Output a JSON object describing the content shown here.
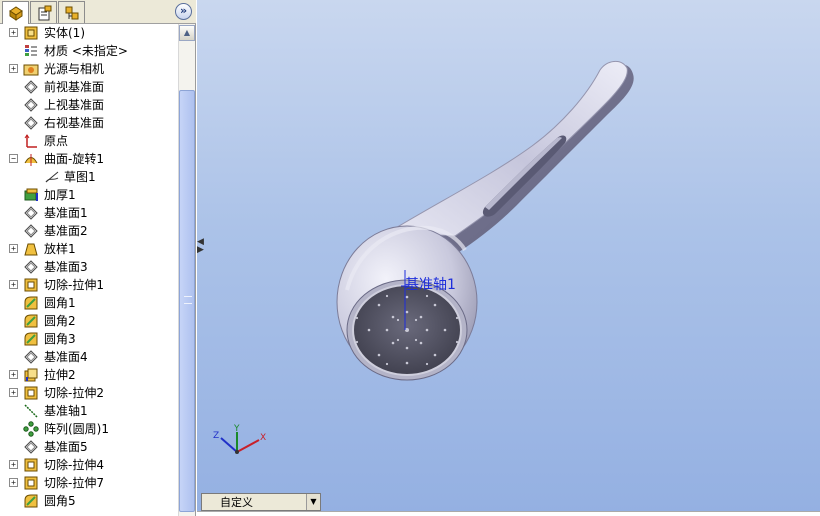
{
  "tabs": [
    {
      "name": "feature-manager-tab",
      "icon": "feature-manager-icon",
      "active": true
    },
    {
      "name": "property-manager-tab",
      "icon": "property-manager-icon",
      "active": false
    },
    {
      "name": "configuration-manager-tab",
      "icon": "configuration-manager-icon",
      "active": false
    }
  ],
  "collapse_glyph": "»",
  "tree": {
    "items": [
      {
        "label": "实体(1)",
        "icon": "solid-bodies-icon",
        "expander": true
      },
      {
        "label": "材质 <未指定>",
        "icon": "material-icon",
        "expander": false
      },
      {
        "label": "光源与相机",
        "icon": "lights-cameras-icon",
        "expander": true
      },
      {
        "label": "前视基准面",
        "icon": "plane-icon",
        "expander": false
      },
      {
        "label": "上视基准面",
        "icon": "plane-icon",
        "expander": false
      },
      {
        "label": "右视基准面",
        "icon": "plane-icon",
        "expander": false
      },
      {
        "label": "原点",
        "icon": "origin-icon",
        "expander": false
      },
      {
        "label": "曲面-旋转1",
        "icon": "revolve-surface-icon",
        "expander": "minus"
      },
      {
        "label": "草图1",
        "icon": "sketch-icon",
        "expander": false,
        "child": true
      },
      {
        "label": "加厚1",
        "icon": "thicken-icon",
        "expander": false
      },
      {
        "label": "基准面1",
        "icon": "plane-icon",
        "expander": false
      },
      {
        "label": "基准面2",
        "icon": "plane-icon",
        "expander": false
      },
      {
        "label": "放样1",
        "icon": "loft-icon",
        "expander": true
      },
      {
        "label": "基准面3",
        "icon": "plane-icon",
        "expander": false
      },
      {
        "label": "切除-拉伸1",
        "icon": "cut-extrude-icon",
        "expander": true
      },
      {
        "label": "圆角1",
        "icon": "fillet-icon",
        "expander": false
      },
      {
        "label": "圆角2",
        "icon": "fillet-icon",
        "expander": false
      },
      {
        "label": "圆角3",
        "icon": "fillet-icon",
        "expander": false
      },
      {
        "label": "基准面4",
        "icon": "plane-icon",
        "expander": false
      },
      {
        "label": "拉伸2",
        "icon": "extrude-icon",
        "expander": true
      },
      {
        "label": "切除-拉伸2",
        "icon": "cut-extrude-icon",
        "expander": true
      },
      {
        "label": "基准轴1",
        "icon": "axis-icon",
        "expander": false
      },
      {
        "label": "阵列(圆周)1",
        "icon": "circular-pattern-icon",
        "expander": false
      },
      {
        "label": "基准面5",
        "icon": "plane-icon",
        "expander": false
      },
      {
        "label": "切除-拉伸4",
        "icon": "cut-extrude-icon",
        "expander": true
      },
      {
        "label": "切除-拉伸7",
        "icon": "cut-extrude-icon",
        "expander": true
      },
      {
        "label": "圆角5",
        "icon": "fillet-icon",
        "expander": false
      }
    ]
  },
  "viewport": {
    "axis_label": "基准轴1",
    "triad": {
      "x": "X",
      "y": "Y",
      "z": "Z"
    }
  },
  "configuration": {
    "value": "自定义"
  },
  "colors": {
    "background_top": "#c9d7ef",
    "background_bottom": "#94b0e2",
    "axis_label": "#1d2ddb",
    "model": "#d3d3e6"
  }
}
